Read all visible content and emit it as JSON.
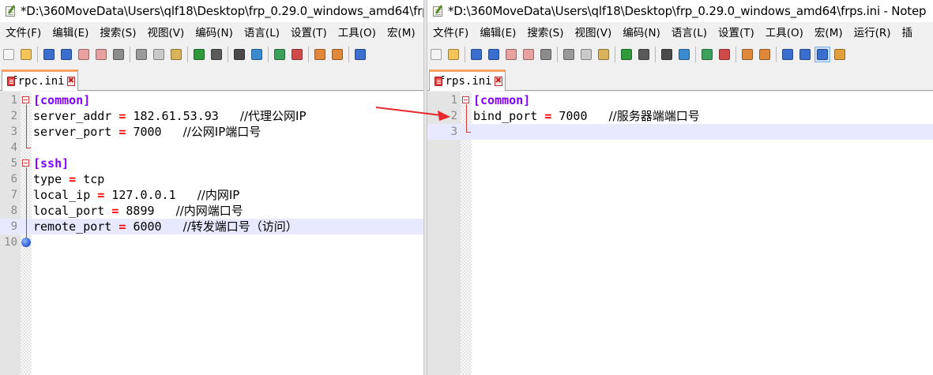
{
  "left_window": {
    "title": "*D:\\360MoveData\\Users\\qlf18\\Desktop\\frp_0.29.0_windows_amd64\\frp",
    "menu": [
      "文件(F)",
      "编辑(E)",
      "搜索(S)",
      "视图(V)",
      "编码(N)",
      "语言(L)",
      "设置(T)",
      "工具(O)",
      "宏(M)"
    ],
    "tab": {
      "label": "frpc.ini",
      "close_glyph": "✖"
    },
    "lines": [
      {
        "num": "1",
        "section": "[common]"
      },
      {
        "num": "2",
        "key": "server_addr",
        "op": "=",
        "value": "182.61.53.93",
        "comment": "//代理公网IP"
      },
      {
        "num": "3",
        "key": "server_port",
        "op": "=",
        "value": "7000",
        "comment": "//公网IP端口号"
      },
      {
        "num": "4"
      },
      {
        "num": "5",
        "section": "[ssh]"
      },
      {
        "num": "6",
        "key": "type",
        "op": "=",
        "value": "tcp"
      },
      {
        "num": "7",
        "key": "local_ip",
        "op": "=",
        "value": "127.0.0.1",
        "comment": "//内网IP"
      },
      {
        "num": "8",
        "key": "local_port",
        "op": "=",
        "value": "8899",
        "comment": "//内网端口号"
      },
      {
        "num": "9",
        "key": "remote_port",
        "op": "=",
        "value": "6000",
        "comment": "//转发端口号（访问）"
      },
      {
        "num": "10"
      }
    ]
  },
  "right_window": {
    "title": "*D:\\360MoveData\\Users\\qlf18\\Desktop\\frp_0.29.0_windows_amd64\\frps.ini - Notep",
    "menu": [
      "文件(F)",
      "编辑(E)",
      "搜索(S)",
      "视图(V)",
      "编码(N)",
      "语言(L)",
      "设置(T)",
      "工具(O)",
      "宏(M)",
      "运行(R)",
      "插"
    ],
    "tab": {
      "label": "frps.ini",
      "close_glyph": "✖"
    },
    "lines": [
      {
        "num": "1",
        "section": "[common]"
      },
      {
        "num": "2",
        "key": "bind_port",
        "op": "=",
        "value": "7000",
        "comment": "//服务器端端口号"
      },
      {
        "num": "3"
      }
    ]
  },
  "toolbar_icons": [
    "new-file",
    "open-file",
    "save",
    "save-all",
    "close",
    "close-all",
    "print",
    "cut",
    "copy",
    "paste",
    "undo",
    "redo",
    "find",
    "replace",
    "zoom-in",
    "zoom-out",
    "sync-vertical",
    "sync-horizontal",
    "word-wrap",
    "show-all-chars",
    "indent-guide",
    "user-defined-language"
  ],
  "colors": {
    "section": "#8000ff",
    "operator": "#ff0000",
    "current_line": "#e8e8ff",
    "fold_marker": "#d53a3a",
    "tab_accent": "#f8a060",
    "annotation_arrow": "#e8282c"
  },
  "annotation": {
    "arrow_color": "#e8282c"
  }
}
